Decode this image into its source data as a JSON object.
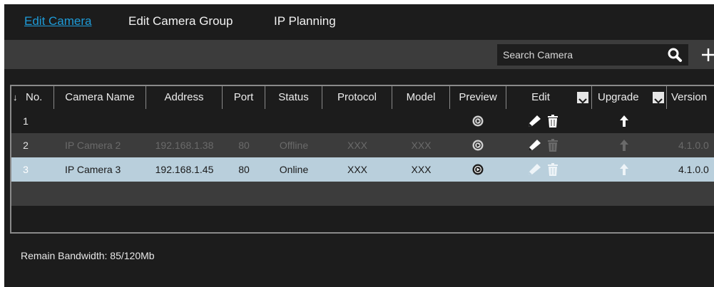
{
  "tabs": [
    {
      "label": "Edit Camera",
      "active": true
    },
    {
      "label": "Edit Camera Group",
      "active": false
    },
    {
      "label": "IP Planning",
      "active": false
    }
  ],
  "search": {
    "placeholder": "Search Camera",
    "value": ""
  },
  "table": {
    "sort_arrow": "↓",
    "columns": [
      "No.",
      "Camera Name",
      "Address",
      "Port",
      "Status",
      "Protocol",
      "Model",
      "Preview",
      "Edit",
      "Upgrade",
      "Version"
    ],
    "rows": [
      {
        "no": "1",
        "name": "",
        "address": "",
        "port": "",
        "status": "",
        "protocol": "",
        "model": "",
        "version": "",
        "state": "default",
        "preview_icon": "play-icon",
        "edit_icon": "pencil-icon",
        "delete_icon": "trash-icon",
        "upgrade_icon": "up-arrow-icon"
      },
      {
        "no": "2",
        "name": "IP Camera 2",
        "address": "192.168.1.38",
        "port": "80",
        "status": "Offline",
        "protocol": "XXX",
        "model": "XXX",
        "version": "4.1.0.0",
        "state": "offline",
        "preview_icon": "play-icon",
        "edit_icon": "pencil-icon",
        "delete_icon": "trash-icon",
        "upgrade_icon": "up-arrow-icon"
      },
      {
        "no": "3",
        "name": "IP Camera 3",
        "address": "192.168.1.45",
        "port": "80",
        "status": "Online",
        "protocol": "XXX",
        "model": "XXX",
        "version": "4.1.0.0",
        "state": "selected",
        "preview_icon": "play-icon",
        "edit_icon": "pencil-icon",
        "delete_icon": "trash-icon",
        "upgrade_icon": "up-arrow-icon"
      }
    ]
  },
  "footer": {
    "bandwidth": "Remain Bandwidth: 85/120Mb"
  },
  "colors": {
    "accent": "#1e9bd8",
    "selected_row": "#b9cfdc",
    "offline_text": "#6a6a6a",
    "background": "#1c1c1c",
    "toolbar": "#3c3c3c"
  }
}
